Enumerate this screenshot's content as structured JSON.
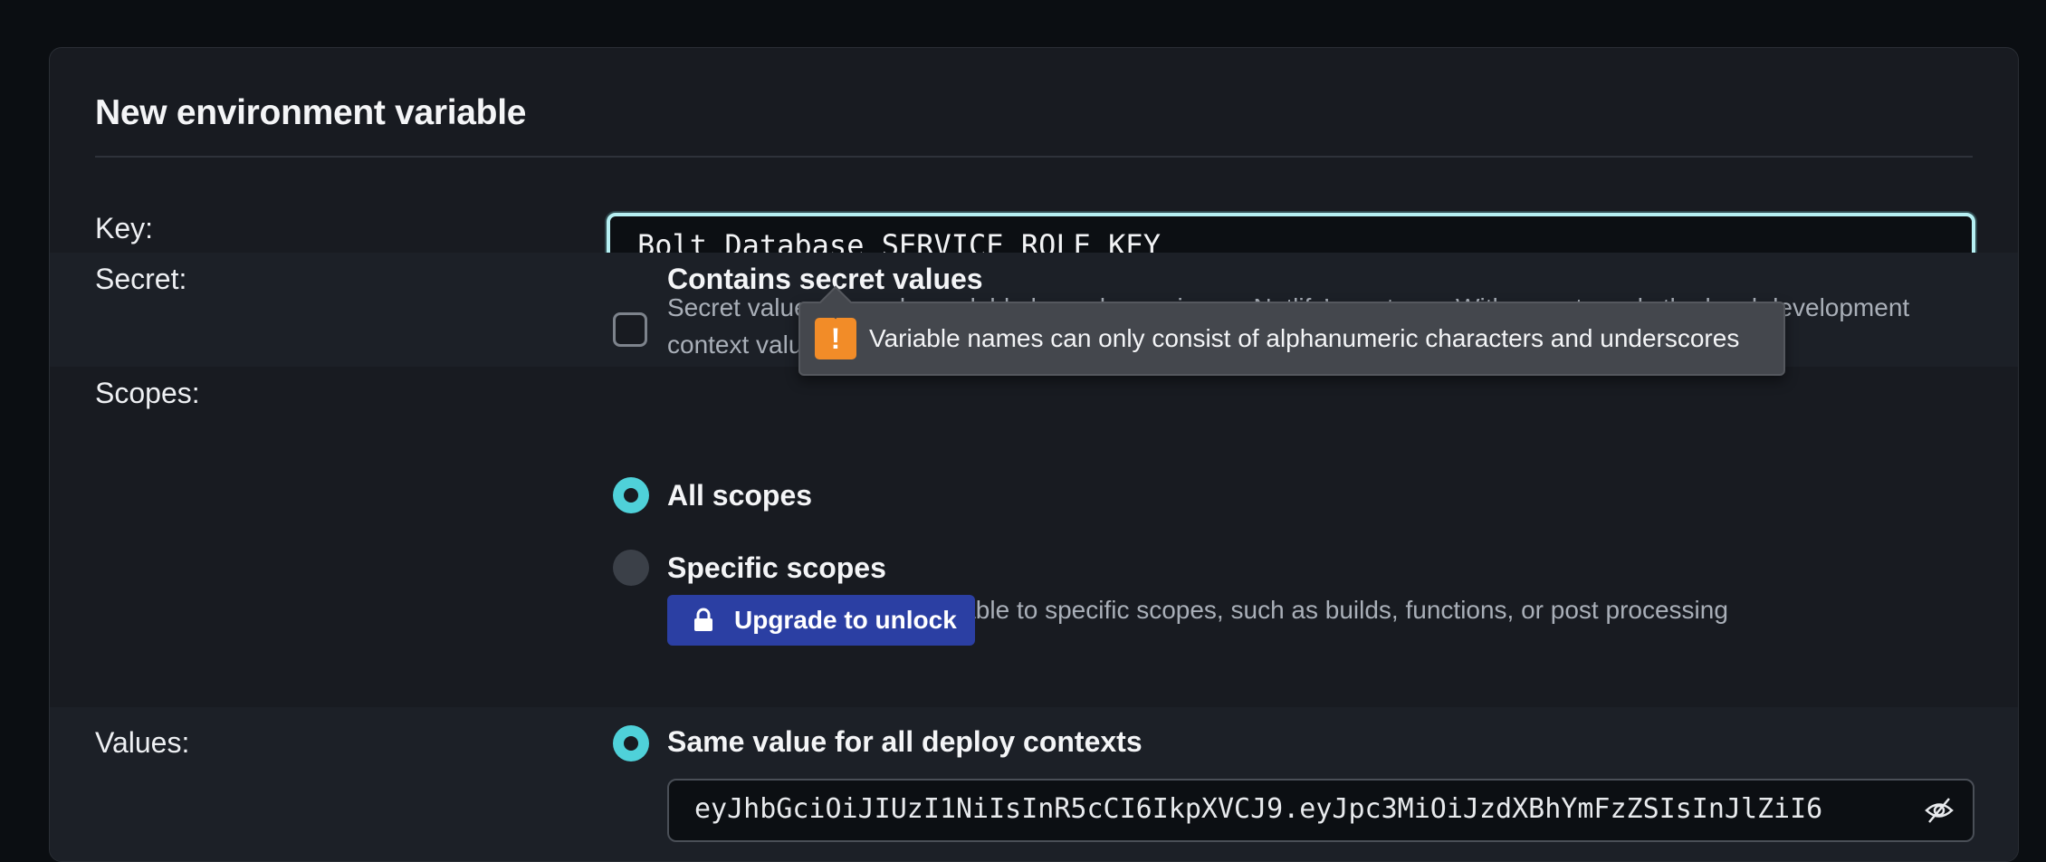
{
  "form": {
    "title": "New environment variable",
    "key_label": "Key:",
    "key_value": "Bolt Database_SERVICE_ROLE_KEY",
    "secret_label": "Secret:",
    "secret_option": "Contains secret values",
    "secret_description_line1": "Secret values are only readable by code running on Netlify’s systems. With secrets, only the local development",
    "secret_description_line2": "context values are readable and unmasked on Netlify’s UI, API, and CLI.",
    "scopes_label": "Scopes:",
    "all_scopes": "All scopes",
    "specific_scopes": "Specific scopes",
    "specific_scopes_description": "Limit this environment variable to specific scopes, such as builds, functions, or post processing",
    "upgrade_button": "Upgrade to unlock",
    "values_label": "Values:",
    "same_value_option": "Same value for all deploy contexts",
    "value_field": "eyJhbGciOiJIUzI1NiIsInR5cCI6IkpXVCJ9.eyJpc3MiOiJzdXBhYmFzZSIsInJlZiI6"
  },
  "tooltip": {
    "message": "Variable names can only consist of alphanumeric characters and underscores",
    "icon": "warning-icon"
  },
  "colors": {
    "accent": "#4fd1d9",
    "button": "#2b3fa3",
    "warning": "#f28c28"
  }
}
